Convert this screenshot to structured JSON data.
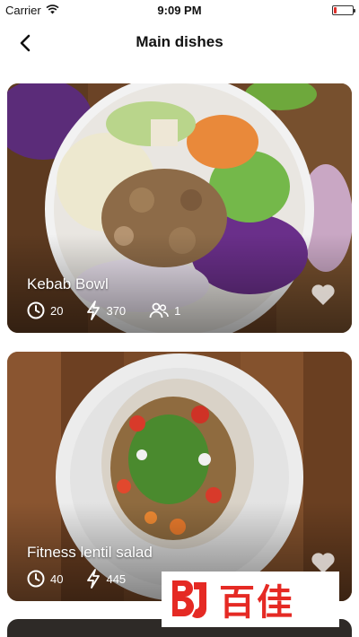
{
  "status_bar": {
    "carrier": "Carrier",
    "time": "9:09 PM",
    "battery_level": 0.12,
    "battery_color": "#e0302b"
  },
  "nav": {
    "back_icon": "chevron-left-icon",
    "title": "Main dishes"
  },
  "dishes": [
    {
      "name": "Kebab Bowl",
      "time": "20",
      "calories": "370",
      "servings": "1",
      "favorite": false
    },
    {
      "name": "Fitness lentil salad",
      "time": "40",
      "calories": "445",
      "servings": "",
      "favorite": false
    }
  ],
  "watermark": {
    "text": "百佳",
    "logo_letters": "BJ"
  },
  "colors": {
    "accent": "#e52a24",
    "card_wood": "#6b4326"
  }
}
